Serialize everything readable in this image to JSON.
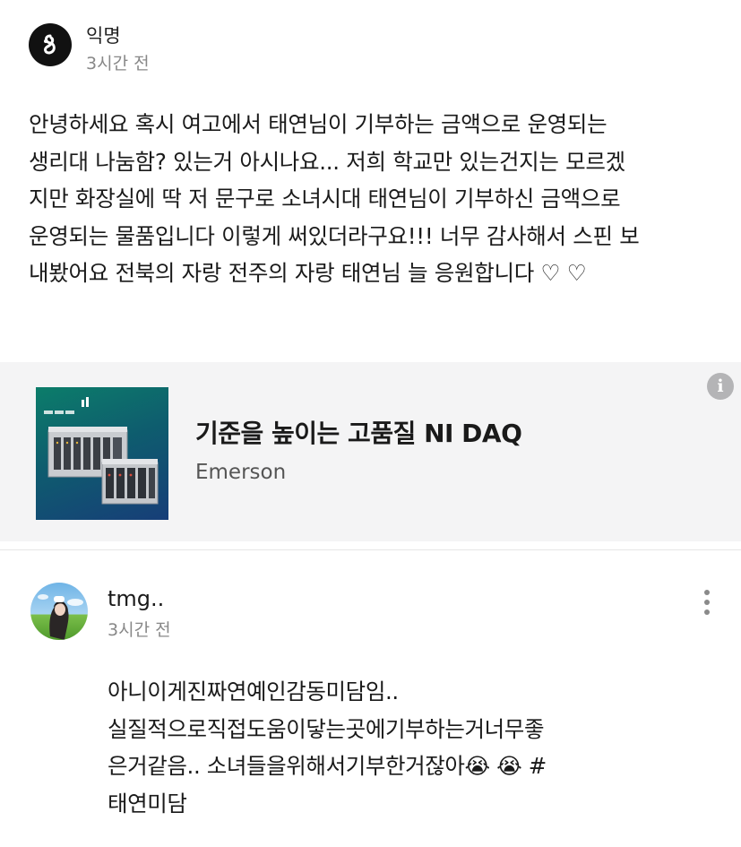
{
  "post": {
    "author": "익명",
    "time": "3시간 전",
    "body": "안녕하세요 혹시 여고에서 태연님이 기부하는 금액으로 운영되는\n생리대 나눔함? 있는거 아시나요... 저희 학교만 있는건지는 모르겠\n지만 화장실에 딱 저 문구로 소녀시대 태연님이 기부하신 금액으로\n운영되는 물품입니다 이렇게 써있더라구요!!! 너무 감사해서 스핀 보\n내봤어요 전북의 자랑 전주의 자랑 태연님 늘 응원합니다 ♡ ♡"
  },
  "ad": {
    "headline": "기준을 높이는 고품질 NI DAQ",
    "advertiser": "Emerson",
    "info_symbol": "i"
  },
  "comment": {
    "author": "tmg..",
    "time": "3시간 전",
    "body": "아니이게진짜연예인감동미담임..\n실질적으로직접도움이닿는곳에기부하는거너무좋\n은거같음.. 소녀들을위해서기부한거잖아😭 😭 #\n태연미담"
  },
  "colors": {
    "avatar_anon": "#111111",
    "ad_background": "#f4f4f5",
    "muted_text": "#888888"
  },
  "icons": {
    "anon_avatar": "anonymous-avatar-icon",
    "ad_info": "info-icon",
    "more": "more-vertical-icon"
  }
}
